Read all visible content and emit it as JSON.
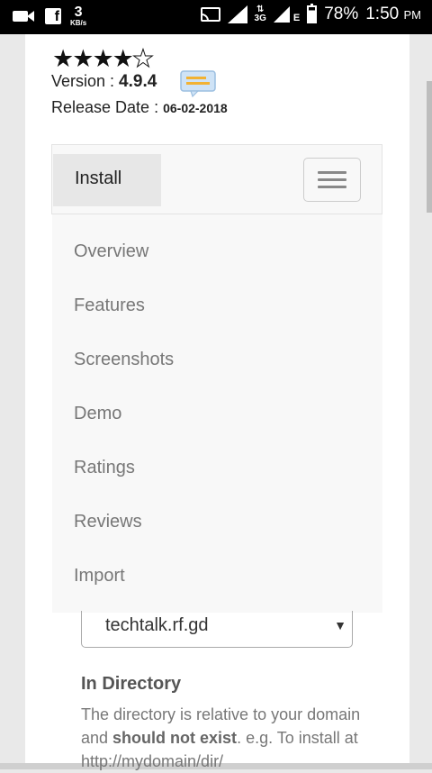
{
  "status_bar": {
    "data_speed": "3",
    "data_unit": "KB/s",
    "network_type": "3G",
    "network_letter": "E",
    "battery": "78%",
    "time": "1:50",
    "ampm": "PM"
  },
  "app": {
    "rating_stars": 4.5,
    "version_label": "Version : ",
    "version_value": "4.9.4",
    "release_label": "Release Date : ",
    "release_value": "06-02-2018"
  },
  "nav": {
    "active_label": "Install",
    "menu_items": [
      "Overview",
      "Features",
      "Screenshots",
      "Demo",
      "Ratings",
      "Reviews",
      "Import"
    ]
  },
  "form": {
    "domain_select_value": "techtalk.rf.gd",
    "directory_heading": "In Directory",
    "directory_text_1": "The directory is relative to your domain and ",
    "directory_text_bold": "should not exist",
    "directory_text_2": ". e.g. To install at http://mydomain/dir/"
  }
}
